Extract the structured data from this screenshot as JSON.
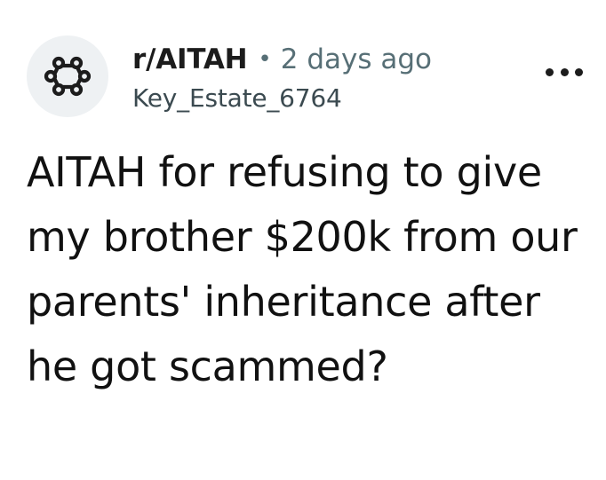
{
  "post": {
    "subreddit": "r/AITAH",
    "separator": "•",
    "age": "2 days ago",
    "author": "Key_Estate_6764",
    "title": "AITAH for refusing to give my brother $200k from our parents' inheritance after he got scammed?"
  },
  "icons": {
    "avatar": "subreddit-default-icon",
    "menu": "more-options-icon"
  },
  "colors": {
    "text": "#1c1c1c",
    "meta": "#576f76",
    "avatar_bg": "#eef1f3"
  }
}
